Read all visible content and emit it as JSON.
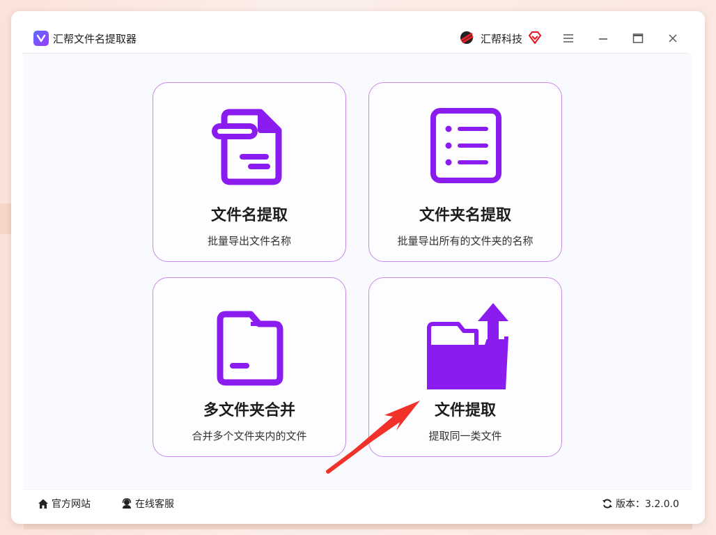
{
  "window": {
    "title": "汇帮文件名提取器",
    "brand": "汇帮科技"
  },
  "cards": [
    {
      "title": "文件名提取",
      "desc": "批量导出文件名称",
      "icon": "file-document-icon"
    },
    {
      "title": "文件夹名提取",
      "desc": "批量导出所有的文件夹的名称",
      "icon": "list-document-icon"
    },
    {
      "title": "多文件夹合并",
      "desc": "合并多个文件夹内的文件",
      "icon": "folder-icon"
    },
    {
      "title": "文件提取",
      "desc": "提取同一类文件",
      "icon": "folder-export-icon"
    }
  ],
  "statusbar": {
    "website": "官方网站",
    "support": "在线客服",
    "version": "版本：3.2.0.0"
  },
  "colors": {
    "accent": "#8a1cf0",
    "card_border": "#c58ae8",
    "annotation_arrow": "#f0322a"
  }
}
